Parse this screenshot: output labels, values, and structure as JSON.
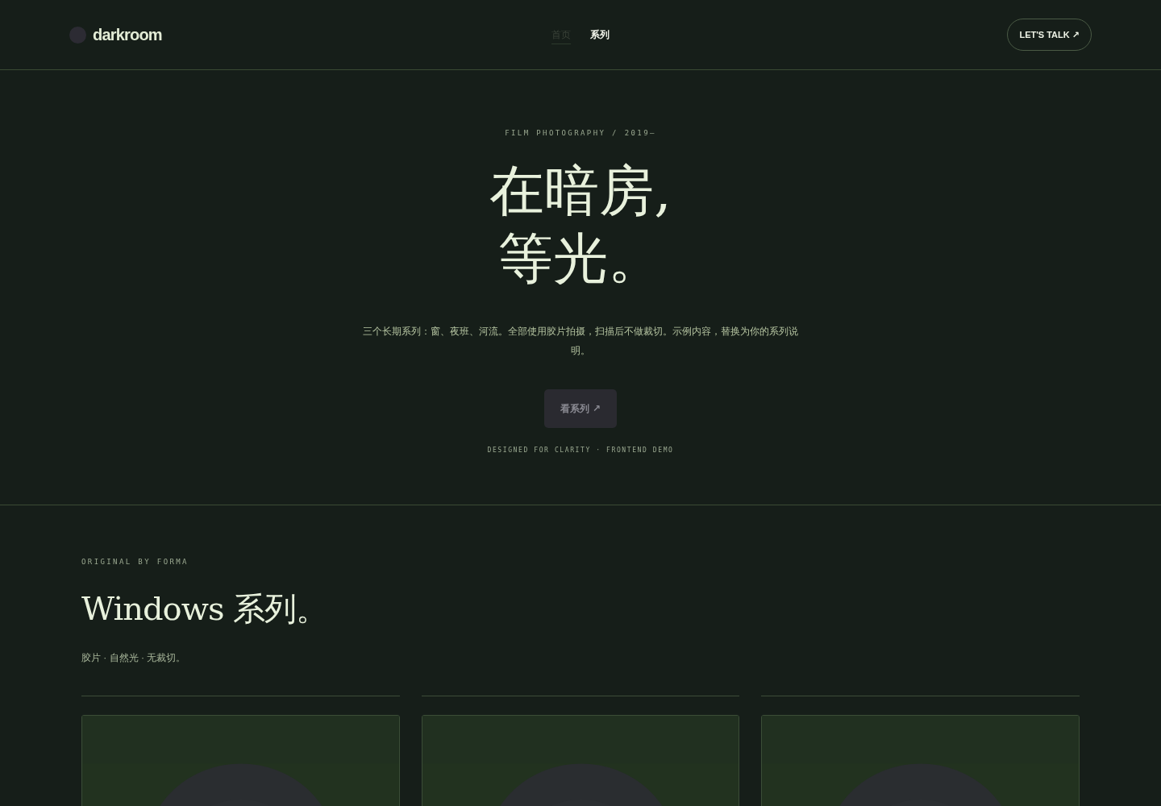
{
  "brand": {
    "name": "darkroom"
  },
  "nav": [
    {
      "label": "首页",
      "selected": true
    },
    {
      "label": "系列",
      "selected": false
    }
  ],
  "contact_button": {
    "label": "LET'S TALK ↗"
  },
  "hero": {
    "eyebrow": "FILM PHOTOGRAPHY / 2019—",
    "title_lines": [
      "在暗房,",
      "等光。"
    ],
    "description": "三个长期系列：窗、夜班、河流。全部使用胶片拍摄，扫描后不做裁切。示例内容，替换为你的系列说明。",
    "button": "看系列 ↗",
    "footnote": "DESIGNED FOR CLARITY · FRONTEND DEMO"
  },
  "section": {
    "eyebrow": "ORIGINAL BY FORMA",
    "title": "Windows 系列。",
    "subtitle": "胶片 · 自然光 · 无裁切。"
  }
}
